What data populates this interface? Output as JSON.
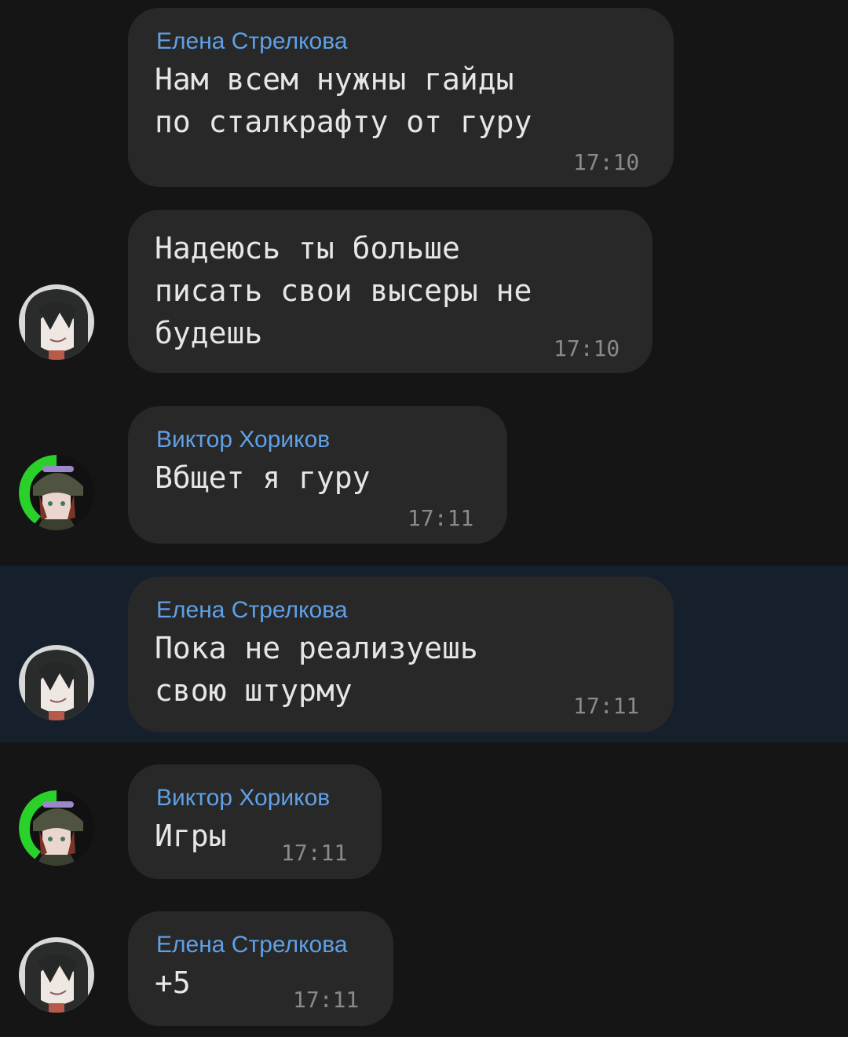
{
  "colors": {
    "background": "#151515",
    "highlight": "#16202d",
    "bubble": "#282828",
    "sender_name": "#5fa0e6",
    "message_text": "#e6e6e6",
    "timestamp": "#8a8a8a",
    "viktor_avatar_ring": "#2bd12b"
  },
  "messages": [
    {
      "sender": "Елена Стрелкова",
      "text": "Нам всем нужны гайды\nпо сталкрафту от гуру",
      "time": "17:10",
      "avatar": null
    },
    {
      "sender": "",
      "text": "Надеюсь ты больше\nписать свои высеры не\nбудешь",
      "time": "17:10",
      "avatar": "elena-avatar"
    },
    {
      "sender": "Виктор Хориков",
      "text": "Вбщет я гуру",
      "time": "17:11",
      "avatar": "viktor-avatar"
    },
    {
      "sender": "Елена Стрелкова",
      "text": "Пока не реализуешь\nсвою штурму",
      "time": "17:11",
      "avatar": "elena-avatar",
      "highlighted": true
    },
    {
      "sender": "Виктор Хориков",
      "text": "Игры",
      "time": "17:11",
      "avatar": "viktor-avatar"
    },
    {
      "sender": "Елена Стрелкова",
      "text": "+5",
      "time": "17:11",
      "avatar": "elena-avatar"
    }
  ]
}
